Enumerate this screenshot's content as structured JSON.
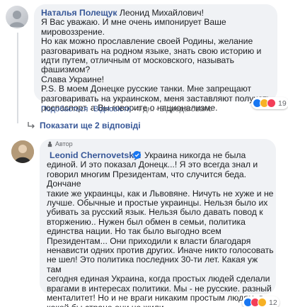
{
  "comment1": {
    "author": "Наталья Полещук",
    "text_after_author": " Леонид Михайлович!\nЯ Вас уважаю. И мне очень импонирует Ваше мировоззрение.\nНо как можно проcлавление своей Родины, желание разговаривать на родном языке, знать свою историю и идти путем, отличным от московского, называть фашизмом?\nСлава Украине!\nP.S. В моем Донецке русские танки. Мне запрещают разговаривать на украинском, меня заставляют получать роспаспорт, а Вы говорите о национализме.",
    "actions": {
      "like": "Подобається",
      "reply": "Відповісти",
      "time": "4 дн.",
      "edited": "Відредаговано"
    },
    "reactions_count": "19"
  },
  "more_replies": "Показати ще 2 відповіді",
  "comment2": {
    "badge": "Автор",
    "author": "Leonid Chernovetskyi",
    "text": "Украина никогда не была\nединой. И это показал Донецк...! Я это всегда знал и\nговорил многим Президентам, что случится беда. Дончане\nтакие же украинцы, как и Львовяне. Ничуть не хуже и не\nлучше. Обычные и простые украинцы. Нельзя было их\nубивать за русский язык. Нельзя было давать повод к\nвторжению.. Нужен был обмен в семьи, политика\nединства нации. Но так было выгодно всем\nПрезидентам... Они приходили к власти благодаря\nненависти одних против других. Иначе никто голосовать\nне шел! Это политика последних 30-ти лет. Какая уж там\nсегодня единая Украина, когда простых людей сделали\nврагами в интересах политики. Мы - не русские. разный\nменталитет! Но и не враги никаким простым людям, в\nкакой бы стране они не жили.",
    "reactions_count": "12"
  },
  "icons": {
    "avatar1": "user-avatar-icon",
    "avatar2": "author-avatar-icon",
    "verified": "verified-badge-icon",
    "reply_arrow": "reply-arrow-icon",
    "badge": "author-badge-icon"
  },
  "colors": {
    "link": "#385898",
    "bubble": "#f0f2f5",
    "muted": "#65676b",
    "like": "#1877f2",
    "love": "#f33e58",
    "haha": "#f7b125"
  }
}
